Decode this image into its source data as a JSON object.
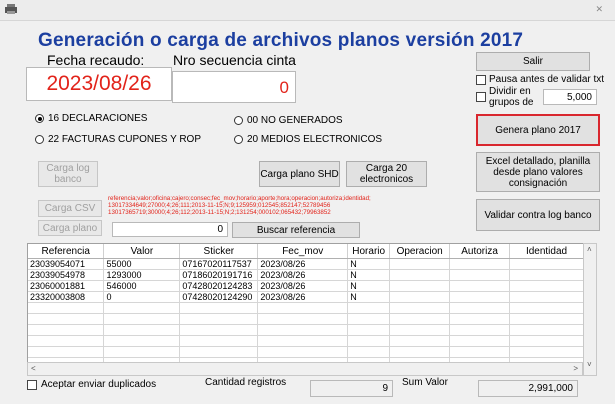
{
  "window": {
    "close_glyph": "✕"
  },
  "header": {
    "title": "Generación o carga de archivos planos versión 2017",
    "fecha_label": "Fecha recaudo:",
    "fecha_value": "2023/08/26",
    "seq_label": "Nro secuencia cinta",
    "seq_value": "0"
  },
  "right_panel": {
    "salir": "Salir",
    "pausa_label": "Pausa antes de validar txt",
    "dividir_label": "Dividir en grupos de",
    "dividir_value": "5,000",
    "genera": "Genera plano 2017",
    "excel": "Excel detallado, planilla desde plano valores consignación",
    "validar": "Validar contra log banco"
  },
  "radios": [
    {
      "label": "16 DECLARACIONES",
      "selected": true
    },
    {
      "label": "00 NO GENERADOS",
      "selected": false
    },
    {
      "label": "22 FACTURAS CUPONES Y ROP",
      "selected": false
    },
    {
      "label": "20 MEDIOS ELECTRONICOS",
      "selected": false
    }
  ],
  "load_panel": {
    "carga_log": "Carga log banco",
    "carga_plano_shd": "Carga plano SHD",
    "carga_20": "Carga 20 electronicos",
    "carga_csv": "Carga CSV",
    "carga_plano": "Carga plano",
    "counter_value": "0",
    "buscar": "Buscar referencia",
    "ref_lines": [
      "referencia;valor;oficina;cajero;consec;fec_mov;horario;aporte;hora;operacion;autoriza;identidad;",
      "13017334649;27000;4;26;111;2013-11-15;N;9;125959;012545;852147;52789456",
      "13017365719;30000;4;26;112;2013-11-15;N;2;131254;000102;065432;79963852"
    ]
  },
  "table": {
    "columns": [
      "Referencia",
      "Valor",
      "Sticker",
      "Fec_mov",
      "Horario",
      "Operacion",
      "Autoriza",
      "Identidad"
    ],
    "rows": [
      [
        "23039054071",
        "55000",
        "07167020117537",
        "2023/08/26",
        "N",
        "",
        "",
        ""
      ],
      [
        "23039054978",
        "1293000",
        "07186020191716",
        "2023/08/26",
        "N",
        "",
        "",
        ""
      ],
      [
        "23060001881",
        "546000",
        "07428020124283",
        "2023/08/26",
        "N",
        "",
        "",
        ""
      ],
      [
        "23320003808",
        "0",
        "07428020124290",
        "2023/08/26",
        "N",
        "",
        "",
        ""
      ]
    ],
    "empty_rows": 7
  },
  "footer": {
    "aceptar_label": "Aceptar enviar duplicados",
    "cantidad_label": "Cantidad registros",
    "cantidad_value": "9",
    "sum_label": "Sum Valor",
    "sum_value": "2,991,000"
  }
}
